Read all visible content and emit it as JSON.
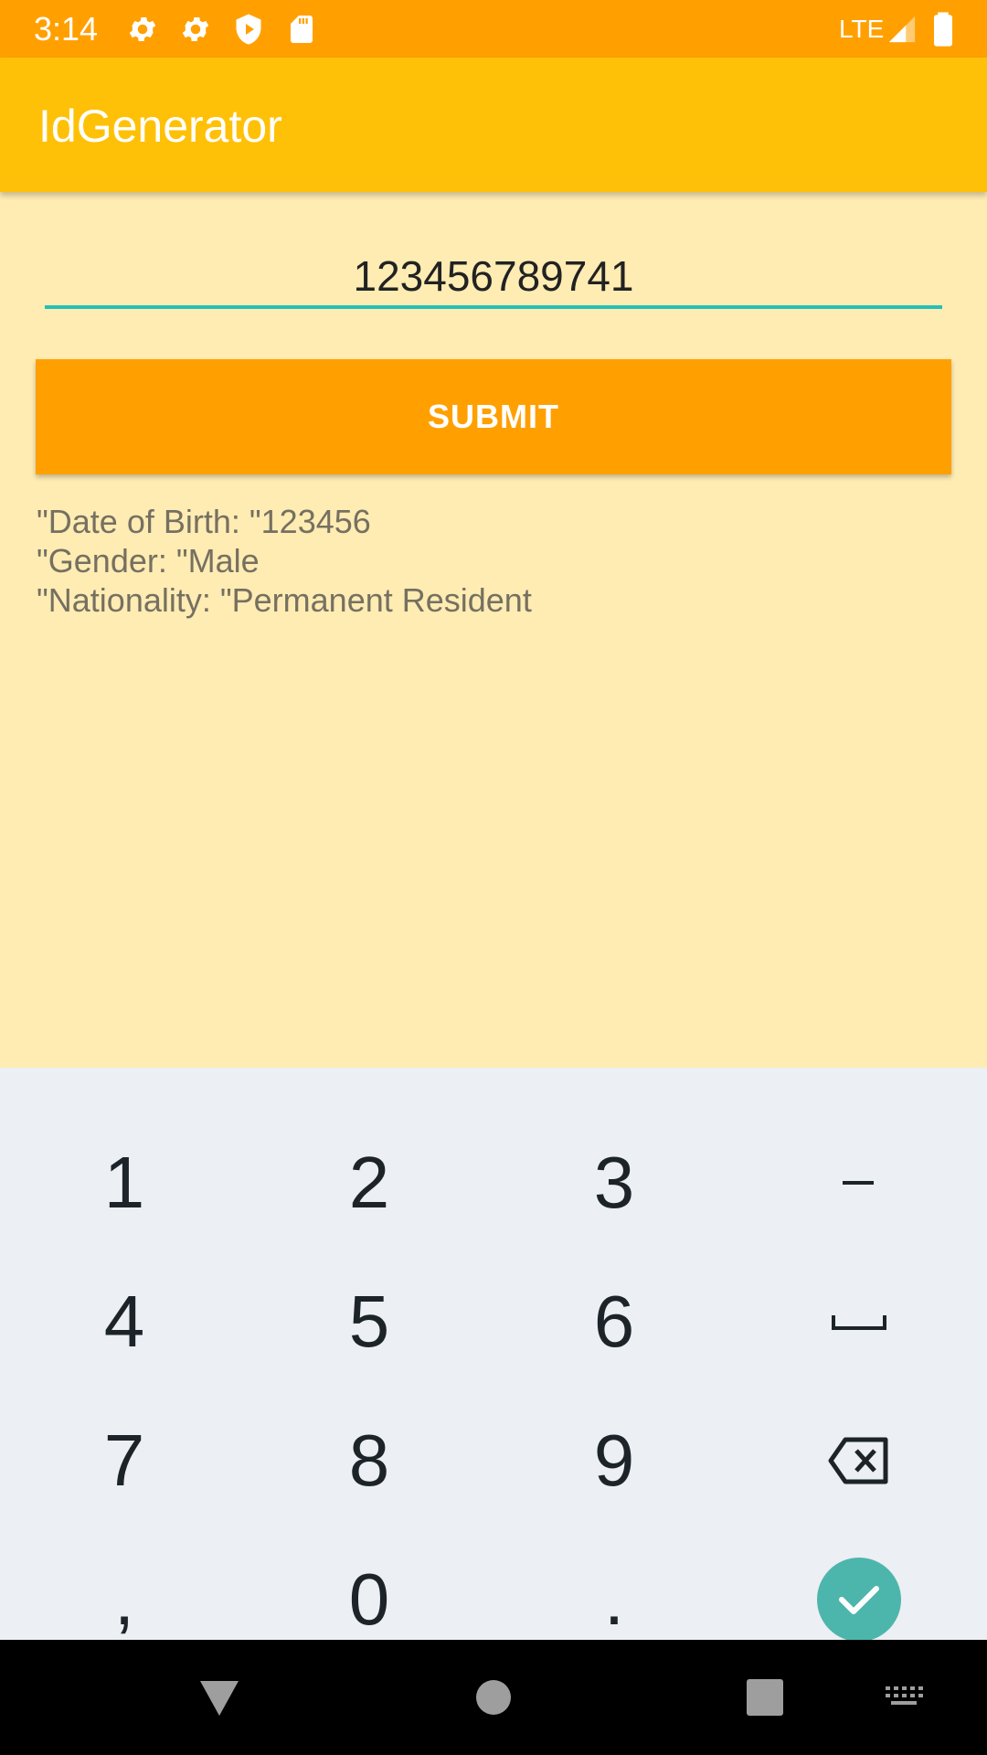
{
  "status_bar": {
    "time": "3:14",
    "icons": [
      "gear-icon",
      "gear-icon",
      "shield-play-icon",
      "sd-card-icon"
    ],
    "network": "LTE",
    "right_icons": [
      "signal-icon",
      "battery-icon"
    ]
  },
  "app_bar": {
    "title": "IdGenerator"
  },
  "form": {
    "id_value": "123456789741",
    "submit_label": "SUBMIT"
  },
  "results": {
    "date_of_birth": "\"Date of Birth: \"123456",
    "gender": "\"Gender: \"Male",
    "nationality": "\"Nationality: \"Permanent Resident"
  },
  "keyboard": {
    "keys": [
      [
        "1",
        "2",
        "3",
        "–"
      ],
      [
        "4",
        "5",
        "6",
        "␣"
      ],
      [
        "7",
        "8",
        "9",
        "⌫"
      ],
      [
        ",",
        "0",
        ".",
        "✓"
      ]
    ],
    "accent_color": "#4DB6AC"
  },
  "nav_bar": {
    "buttons": [
      "back-icon",
      "home-icon",
      "recents-icon",
      "keyboard-switch-icon"
    ]
  },
  "colors": {
    "status_bar": "#FFA000",
    "app_bar": "#FFC107",
    "background": "#FFECB3",
    "input_underline": "#26BFB8",
    "button": "#FFA000"
  }
}
